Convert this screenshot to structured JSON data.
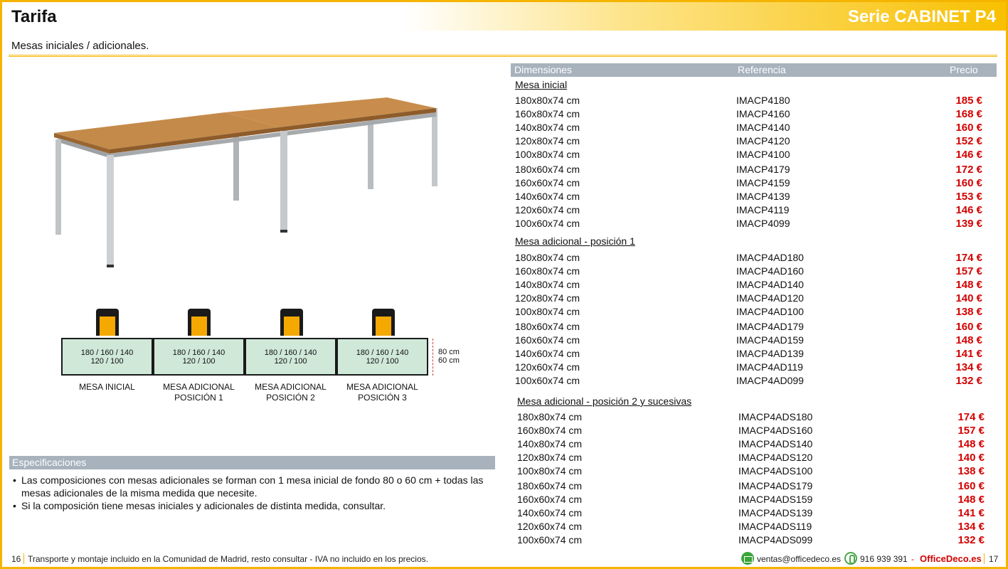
{
  "header": {
    "title": "Tarifa",
    "series": "Serie CABINET P4"
  },
  "subtitle": "Mesas iniciales / adicionales.",
  "diagram": {
    "desks": [
      {
        "line1": "180 / 160 / 140",
        "line2": "120 / 100",
        "cap1": "MESA INICIAL",
        "cap2": ""
      },
      {
        "line1": "180 / 160 / 140",
        "line2": "120 / 100",
        "cap1": "MESA ADICIONAL",
        "cap2": "POSICIÓN 1"
      },
      {
        "line1": "180 / 160 / 140",
        "line2": "120 / 100",
        "cap1": "MESA ADICIONAL",
        "cap2": "POSICIÓN 2"
      },
      {
        "line1": "180 / 160 / 140",
        "line2": "120 / 100",
        "cap1": "MESA ADICIONAL",
        "cap2": "POSICIÓN 3"
      }
    ],
    "depth1": "80 cm",
    "depth2": "60 cm",
    "desk_color": "#cfe8d8",
    "seat_color": "#f5a800"
  },
  "specs": {
    "title": "Especificaciones",
    "items": [
      "Las composiciones con mesas adicionales se forman con 1 mesa inicial de fondo 80 o 60 cm + todas las mesas adicionales de la misma medida que necesite.",
      "Si la composición tiene mesas iniciales y adicionales de distinta medida, consultar."
    ]
  },
  "price_table": {
    "headers": {
      "dim": "Dimensiones",
      "ref": "Referencia",
      "price": "Precio"
    },
    "sections": [
      {
        "title": "Mesa inicial",
        "rows": [
          {
            "dim": "180x80x74 cm",
            "ref": "IMACP4180",
            "price": "185 €"
          },
          {
            "dim": "160x80x74 cm",
            "ref": "IMACP4160",
            "price": "168 €"
          },
          {
            "dim": "140x80x74 cm",
            "ref": "IMACP4140",
            "price": "160 €"
          },
          {
            "dim": "120x80x74 cm",
            "ref": "IMACP4120",
            "price": "152 €"
          },
          {
            "dim": "100x80x74 cm",
            "ref": "IMACP4100",
            "price": "146 €"
          },
          {
            "dim": "180x60x74 cm",
            "ref": "IMACP4179",
            "price": "172 €"
          },
          {
            "dim": "160x60x74 cm",
            "ref": "IMACP4159",
            "price": "160 €"
          },
          {
            "dim": "140x60x74 cm",
            "ref": "IMACP4139",
            "price": "153 €"
          },
          {
            "dim": "120x60x74 cm",
            "ref": "IMACP4119",
            "price": "146 €"
          },
          {
            "dim": "100x60x74 cm",
            "ref": "IMACP4099",
            "price": "139 €"
          }
        ]
      },
      {
        "title": "Mesa adicional - posición 1",
        "rows": [
          {
            "dim": "180x80x74 cm",
            "ref": "IMACP4AD180",
            "price": "174 €"
          },
          {
            "dim": "160x80x74 cm",
            "ref": "IMACP4AD160",
            "price": "157 €"
          },
          {
            "dim": "140x80x74 cm",
            "ref": "IMACP4AD140",
            "price": "148 €"
          },
          {
            "dim": "120x80x74 cm",
            "ref": "IMACP4AD120",
            "price": "140 €"
          },
          {
            "dim": "100x80x74 cm",
            "ref": "IMACP4AD100",
            "price": "138 €"
          },
          {
            "dim": "180x60x74 cm",
            "ref": "IMACP4AD179",
            "price": "160 €"
          },
          {
            "dim": "160x60x74 cm",
            "ref": "IMACP4AD159",
            "price": "148 €"
          },
          {
            "dim": "140x60x74 cm",
            "ref": "IMACP4AD139",
            "price": "141 €"
          },
          {
            "dim": "120x60x74 cm",
            "ref": "IMACP4AD119",
            "price": "134 €"
          },
          {
            "dim": "100x60x74 cm",
            "ref": "IMACP4AD099",
            "price": "132 €"
          }
        ]
      },
      {
        "title": "Mesa adicional - posición 2 y sucesivas",
        "rows": [
          {
            "dim": "180x80x74 cm",
            "ref": "IMACP4ADS180",
            "price": "174 €"
          },
          {
            "dim": "160x80x74 cm",
            "ref": "IMACP4ADS160",
            "price": "157 €"
          },
          {
            "dim": "140x80x74 cm",
            "ref": "IMACP4ADS140",
            "price": "148 €"
          },
          {
            "dim": "120x80x74 cm",
            "ref": "IMACP4ADS120",
            "price": "140 €"
          },
          {
            "dim": "100x80x74 cm",
            "ref": "IMACP4ADS100",
            "price": "138 €"
          },
          {
            "dim": "180x60x74 cm",
            "ref": "IMACP4ADS179",
            "price": "160 €"
          },
          {
            "dim": "160x60x74 cm",
            "ref": "IMACP4ADS159",
            "price": "148 €"
          },
          {
            "dim": "140x60x74 cm",
            "ref": "IMACP4ADS139",
            "price": "141 €"
          },
          {
            "dim": "120x60x74 cm",
            "ref": "IMACP4ADS119",
            "price": "134 €"
          },
          {
            "dim": "100x60x74 cm",
            "ref": "IMACP4ADS099",
            "price": "132 €"
          }
        ]
      }
    ],
    "price_color": "#d40000"
  },
  "footer": {
    "page_left": "16",
    "note": "Transporte y montaje incluido en la Comunidad de Madrid, resto consultar - IVA no incluido en los precios.",
    "email": "ventas@officedeco.es",
    "phone": "916 939 391",
    "dash": "-",
    "brand": "OfficeDeco.es",
    "page_right": "17",
    "mail_icon": "mail-icon",
    "phone_icon": "phone-icon"
  },
  "colors": {
    "accent": "#f5b400",
    "bar": "#a7b2bd"
  }
}
